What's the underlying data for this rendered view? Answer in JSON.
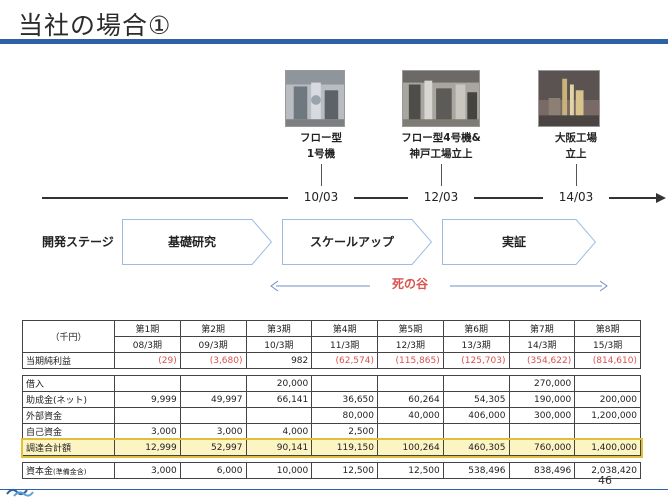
{
  "slide": {
    "title": "当社の場合①",
    "page_number": "46"
  },
  "milestones": [
    {
      "photo": "prototype-machine-photo",
      "line1": "フロー型",
      "line2": "1号機"
    },
    {
      "photo": "kobe-factory-photo",
      "line1": "フロー型4号機&",
      "line2": "神戸工場立上"
    },
    {
      "photo": "osaka-factory-photo",
      "line1": "大阪工場",
      "line2": "立上"
    }
  ],
  "timeline": {
    "dates": [
      "10/03",
      "12/03",
      "14/03"
    ]
  },
  "stages": {
    "title": "開発ステージ",
    "items": [
      "基礎研究",
      "スケールアップ",
      "実証"
    ]
  },
  "valley_of_death": "死の谷",
  "colors": {
    "brand": "#2d62a6",
    "negative": "#d9534f",
    "highlight": "#fdf4c3",
    "highlight_border": "#e0c03a"
  },
  "table": {
    "unit": "（千円）",
    "periods": [
      "第1期",
      "第2期",
      "第3期",
      "第4期",
      "第5期",
      "第6期",
      "第7期",
      "第8期"
    ],
    "fiscal": [
      "08/3期",
      "09/3期",
      "10/3期",
      "11/3期",
      "12/3期",
      "13/3期",
      "14/3期",
      "15/3期"
    ],
    "net_income": {
      "label": "当期純利益",
      "values": [
        "(29)",
        "(3,680)",
        "982",
        "(62,574)",
        "(115,865)",
        "(125,703)",
        "(354,622)",
        "(814,610)"
      ]
    },
    "funding_rows": [
      {
        "label": "借入",
        "values": [
          "",
          "",
          "20,000",
          "",
          "",
          "",
          "270,000",
          ""
        ]
      },
      {
        "label": "助成金(ネット)",
        "values": [
          "9,999",
          "49,997",
          "66,141",
          "36,650",
          "60,264",
          "54,305",
          "190,000",
          "200,000"
        ]
      },
      {
        "label": "外部資金",
        "values": [
          "",
          "",
          "",
          "80,000",
          "40,000",
          "406,000",
          "300,000",
          "1,200,000"
        ]
      },
      {
        "label": "自己資金",
        "values": [
          "3,000",
          "3,000",
          "4,000",
          "2,500",
          "",
          "",
          "",
          ""
        ]
      }
    ],
    "total": {
      "label": "調達合計額",
      "values": [
        "12,999",
        "52,997",
        "90,141",
        "119,150",
        "100,264",
        "460,305",
        "760,000",
        "1,400,000"
      ]
    },
    "capital": {
      "label": "資本金",
      "label_note": "(準備金含)",
      "values": [
        "3,000",
        "6,000",
        "10,000",
        "12,500",
        "12,500",
        "538,496",
        "838,496",
        "2,038,420"
      ]
    }
  }
}
